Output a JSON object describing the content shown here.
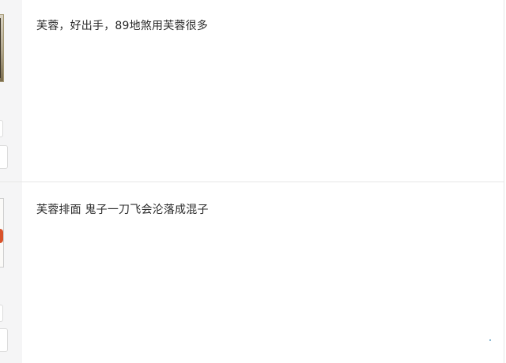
{
  "posts": [
    {
      "title": "芙蓉，好出手，89地煞用芙蓉很多"
    },
    {
      "title": "芙蓉排面 鬼子一刀飞会沦落成混子"
    }
  ]
}
